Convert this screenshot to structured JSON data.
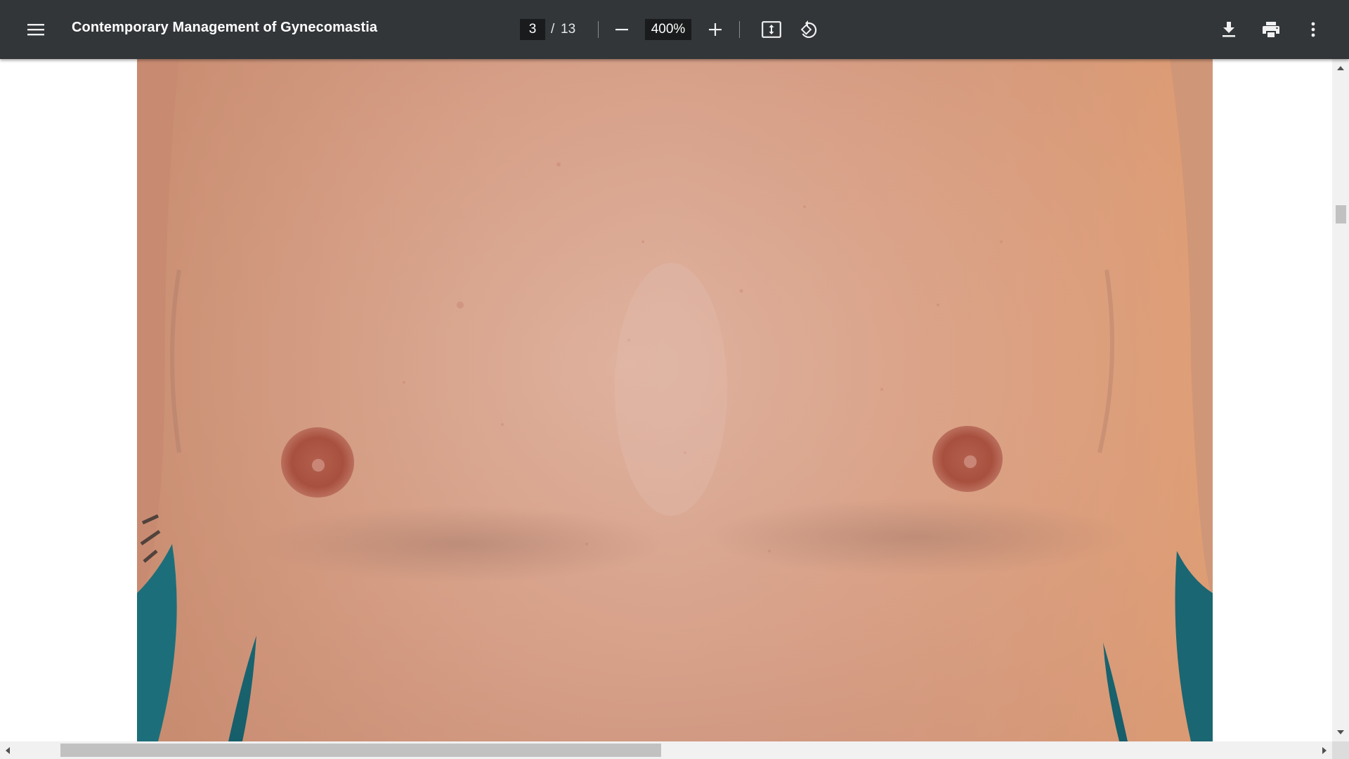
{
  "toolbar": {
    "menu_icon": "hamburger-menu-icon",
    "title": "Contemporary Management of Gynecomastia",
    "page_current": "3",
    "page_separator": "/",
    "page_total": "13",
    "zoom_value": "400%",
    "zoom_out_icon": "minus-icon",
    "zoom_in_icon": "plus-icon",
    "fit_icon": "fit-to-page-icon",
    "rotate_icon": "rotate-counterclockwise-icon",
    "download_icon": "download-icon",
    "print_icon": "printer-icon",
    "more_icon": "more-vert-icon"
  },
  "document": {
    "image_subject": "clinical photograph, frontal view of male chest"
  },
  "colors": {
    "toolbar_bg": "#323639",
    "toolbar_text": "#f1f1f1",
    "input_bg": "#191b1c",
    "skin": "#d9a48a",
    "background_teal": "#1f6d78",
    "scrollbar_track": "#f1f1f1",
    "scrollbar_thumb": "#c1c1c1"
  }
}
